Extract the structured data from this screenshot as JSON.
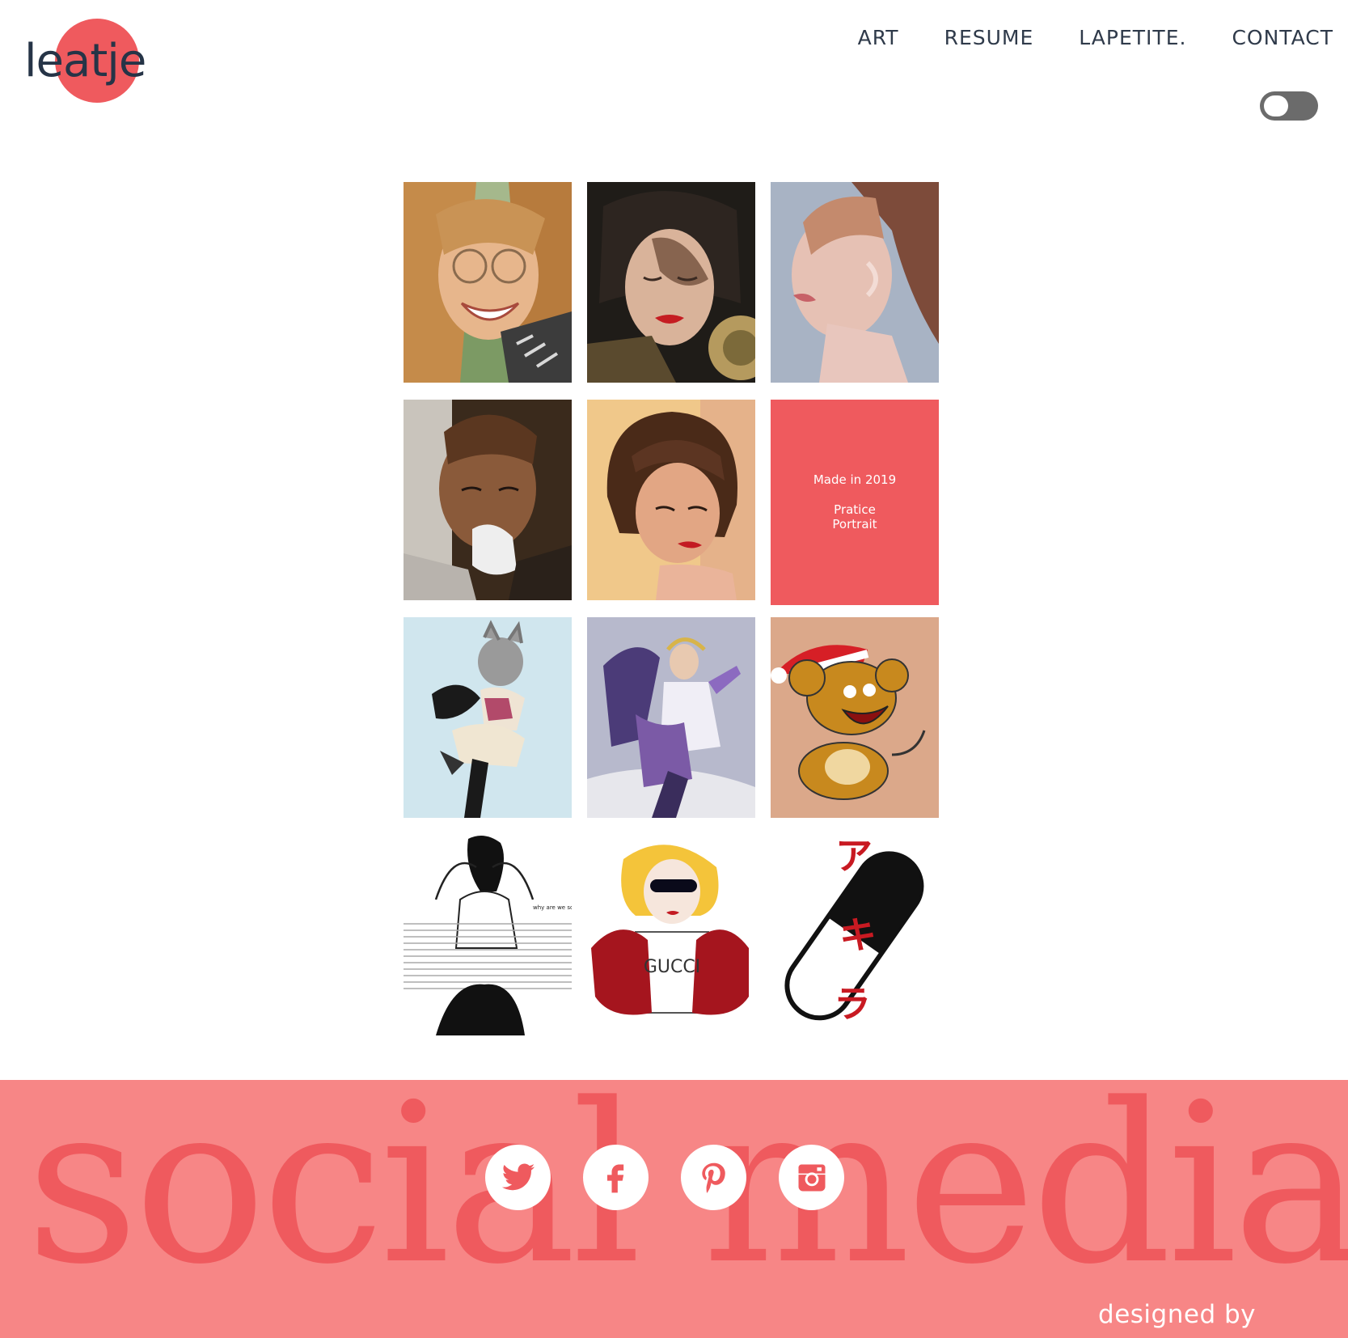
{
  "header": {
    "logo_text": "leatje",
    "nav": [
      "ART",
      "RESUME",
      "LAPETITE.",
      "CONTACT"
    ],
    "theme_toggle": {
      "state": "off"
    }
  },
  "gallery": {
    "info_tile": {
      "line1": "Made in 2019",
      "line2": "Pratice",
      "line3": "Portrait"
    },
    "artworks": [
      "portrait-smiling-woman-glasses",
      "portrait-woman-eyes-closed-red-lips",
      "portrait-woman-profile-light",
      "portrait-woman-with-tissue",
      "portrait-woman-bob-hair",
      "anime-catgirl-dress",
      "fantasy-warrior-purple",
      "cartoon-mouse-santa-hat",
      "lineart-woman-arms-up",
      "illustration-blonde-red-jacket",
      "pill-with-japanese-text"
    ],
    "pill_text": [
      "ア",
      "キ",
      "ラ"
    ],
    "lineart_caption": "why are we so obsessed?",
    "shirt_text": "GUCCI"
  },
  "footer": {
    "big_word": "social media",
    "socials": [
      "twitter-icon",
      "facebook-icon",
      "pinterest-icon",
      "instagram-icon"
    ],
    "designed_by": "designed by"
  },
  "colors": {
    "accent": "#ef5a5e",
    "footer_bg": "#f78686",
    "nav_text": "#2f3a4a"
  }
}
